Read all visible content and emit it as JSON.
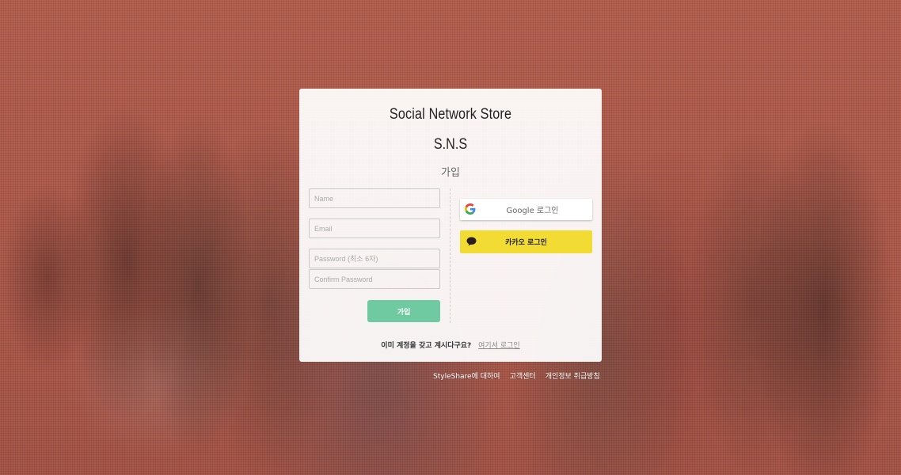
{
  "brand": {
    "title": "Social Network Store",
    "subtitle": "S.N.S"
  },
  "signup": {
    "heading": "가입",
    "name_placeholder": "Name",
    "email_placeholder": "Email",
    "password_placeholder": "Password (최소 6자)",
    "confirm_placeholder": "Confirm Password",
    "submit_label": "가입"
  },
  "social": {
    "google_label": "Google 로그인",
    "kakao_label": "카카오 로그인"
  },
  "login_prompt": {
    "question": "이미 계정을 갖고 계시다구요?",
    "link": "여기서 로그인"
  },
  "footer": {
    "about": "StyleShare에 대하여",
    "support": "고객센터",
    "privacy": "개인정보 취급방침"
  },
  "colors": {
    "background": "#b5614f",
    "submit": "#6fcaa1",
    "kakao": "#f2dc34"
  },
  "icons": {
    "google": "google-icon",
    "kakao": "kakao-chat-icon"
  }
}
